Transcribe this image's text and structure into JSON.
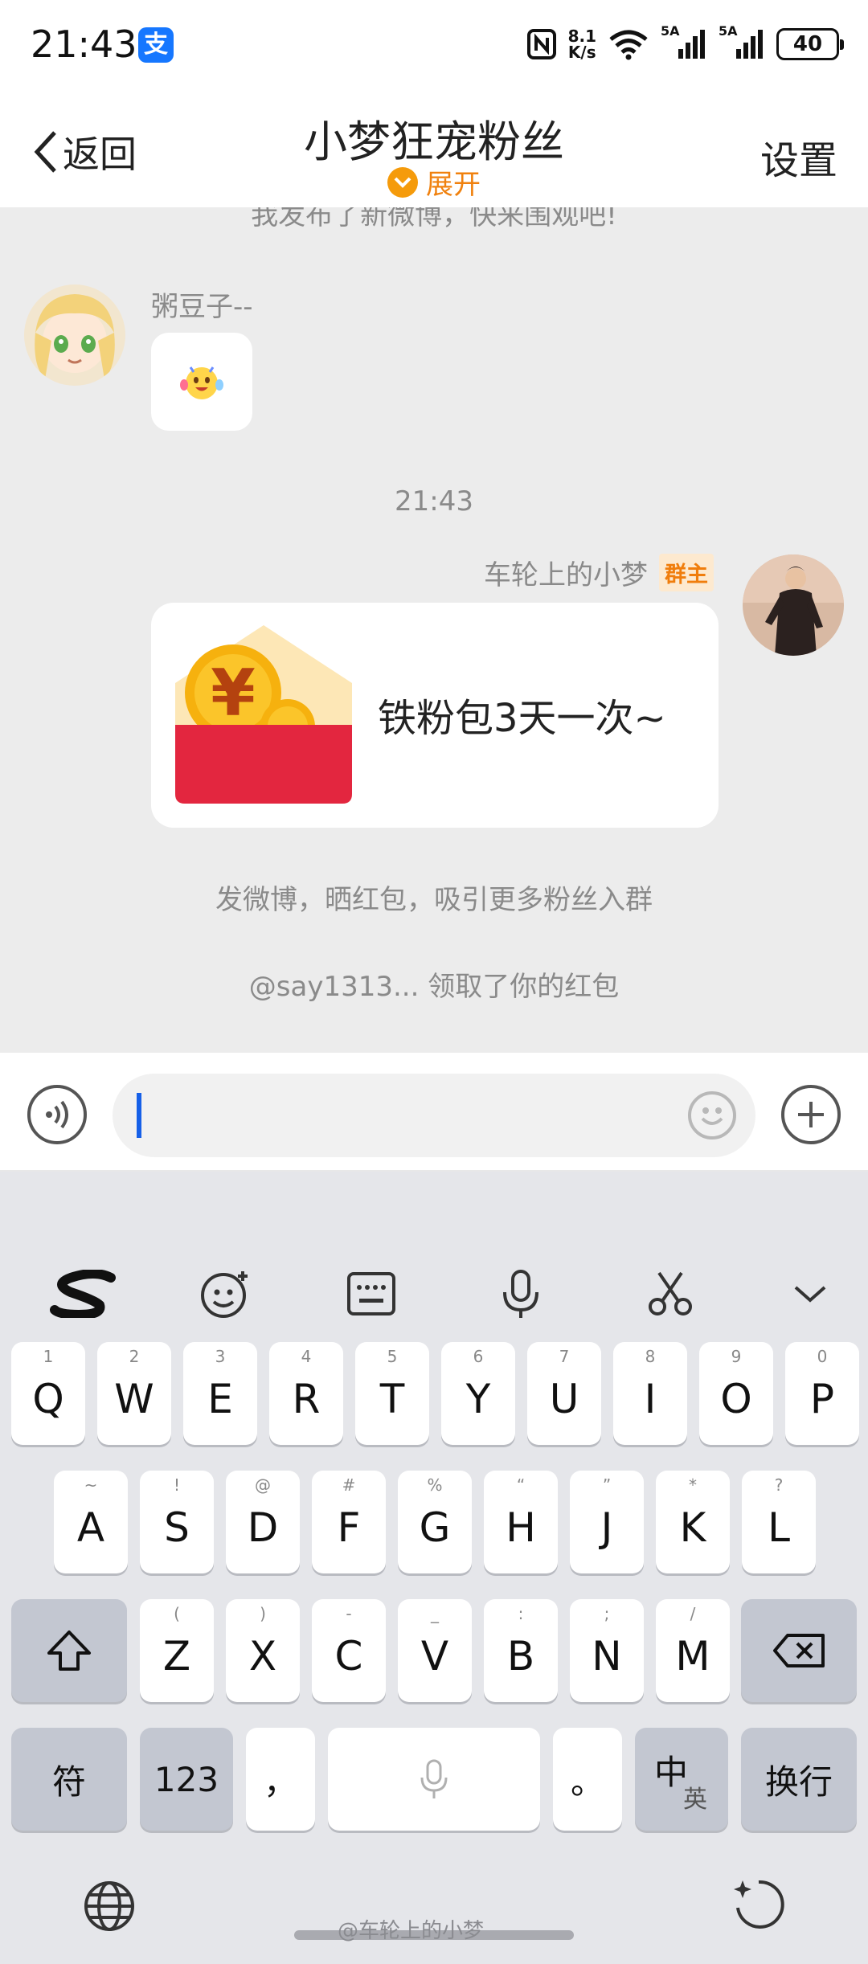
{
  "status_bar": {
    "time": "21:43",
    "alipay_badge": "支",
    "net_speed_value": "8.1",
    "net_speed_unit": "K/s",
    "signal_1": "5A",
    "signal_2": "5A",
    "battery": "40"
  },
  "header": {
    "back_label": "返回",
    "title": "小梦狂宠粉丝",
    "expand_label": "展开",
    "settings_label": "设置"
  },
  "chat": {
    "truncated_message": "我发布了新微博，快来围观吧!",
    "message_1": {
      "sender": "粥豆子--"
    },
    "timestamp": "21:43",
    "message_2": {
      "sender": "车轮上的小梦",
      "badge": "群主",
      "red_packet_text": "铁粉包3天一次~",
      "red_packet_symbol": "¥"
    },
    "system_message_1": "发微博，晒红包，吸引更多粉丝入群",
    "system_message_2": "@say1313... 领取了你的红包"
  },
  "input_bar": {
    "value": ""
  },
  "keyboard": {
    "row1": [
      {
        "main": "Q",
        "hint": "1"
      },
      {
        "main": "W",
        "hint": "2"
      },
      {
        "main": "E",
        "hint": "3"
      },
      {
        "main": "R",
        "hint": "4"
      },
      {
        "main": "T",
        "hint": "5"
      },
      {
        "main": "Y",
        "hint": "6"
      },
      {
        "main": "U",
        "hint": "7"
      },
      {
        "main": "I",
        "hint": "8"
      },
      {
        "main": "O",
        "hint": "9"
      },
      {
        "main": "P",
        "hint": "0"
      }
    ],
    "row2": [
      {
        "main": "A",
        "hint": "~"
      },
      {
        "main": "S",
        "hint": "!"
      },
      {
        "main": "D",
        "hint": "@"
      },
      {
        "main": "F",
        "hint": "#"
      },
      {
        "main": "G",
        "hint": "%"
      },
      {
        "main": "H",
        "hint": "“"
      },
      {
        "main": "J",
        "hint": "”"
      },
      {
        "main": "K",
        "hint": "*"
      },
      {
        "main": "L",
        "hint": "?"
      }
    ],
    "row3": [
      {
        "main": "Z",
        "hint": "("
      },
      {
        "main": "X",
        "hint": ")"
      },
      {
        "main": "C",
        "hint": "-"
      },
      {
        "main": "V",
        "hint": "_"
      },
      {
        "main": "B",
        "hint": ":"
      },
      {
        "main": "N",
        "hint": ";"
      },
      {
        "main": "M",
        "hint": "/"
      }
    ],
    "symbols_key": "符",
    "numbers_key": "123",
    "comma_key": "，",
    "period_key": "。",
    "lang_key_main": "中",
    "lang_key_sub": "英",
    "enter_key": "换行"
  },
  "watermark": "@车轮上的小梦",
  "colors": {
    "accent_orange": "#f0810e",
    "chat_background": "#ececec",
    "keyboard_background": "#e5e6ea",
    "caret_blue": "#1660e8"
  },
  "icons": [
    "nfc-icon",
    "wifi-icon",
    "signal-icon",
    "battery-icon",
    "chevron-left-icon",
    "chevron-down-icon",
    "voice-icon",
    "emoji-icon",
    "plus-icon",
    "swype-icon",
    "sticker-icon",
    "keyboard-icon",
    "microphone-icon",
    "scissors-icon",
    "hide-keyboard-icon",
    "shift-icon",
    "backspace-icon",
    "globe-icon",
    "sparkle-refresh-icon"
  ]
}
